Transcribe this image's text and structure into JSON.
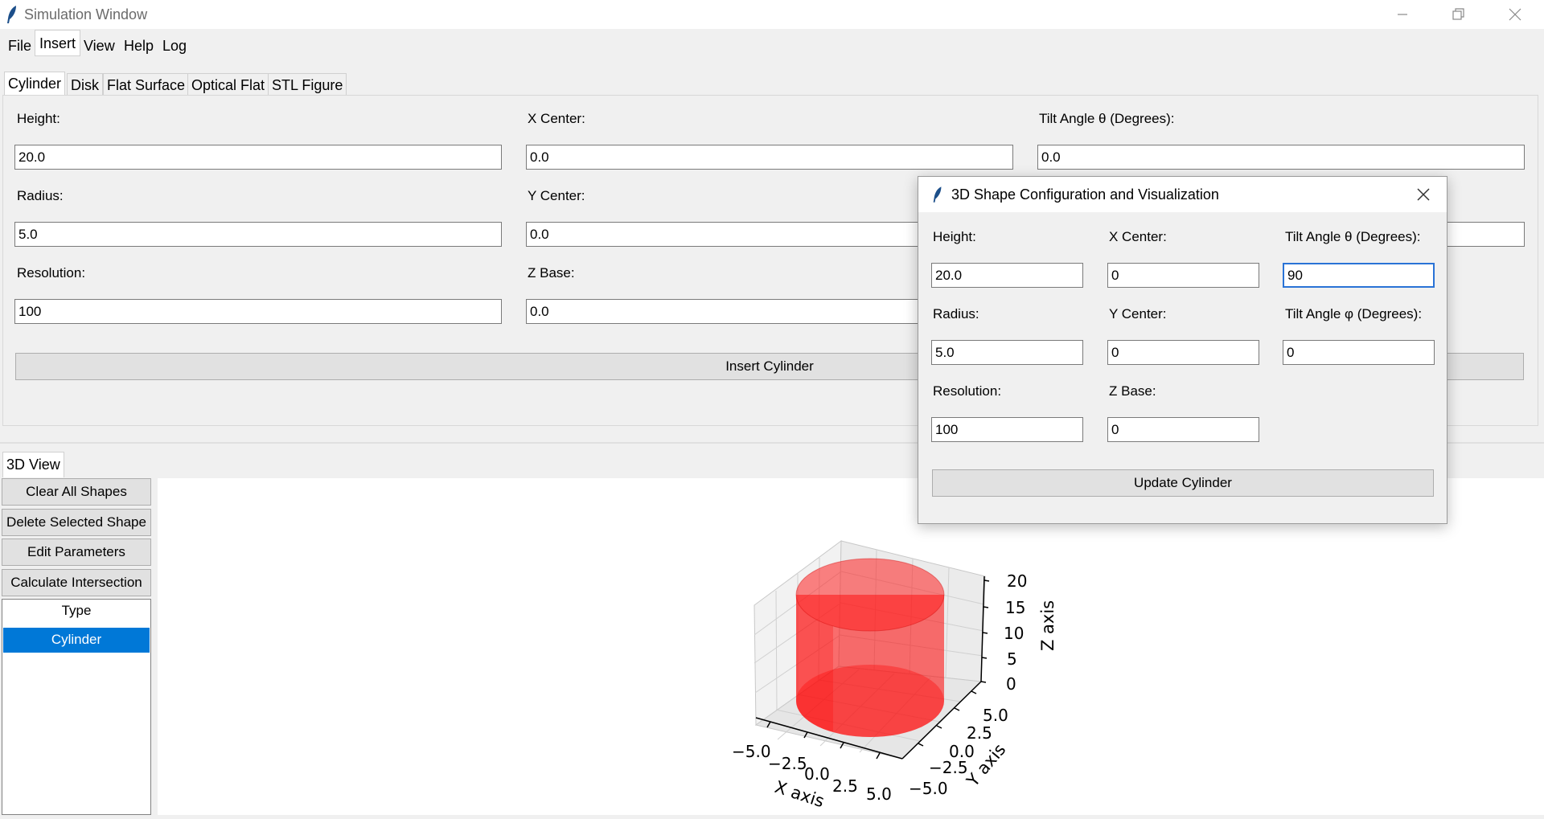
{
  "window": {
    "title": "Simulation Window"
  },
  "menu": [
    "File",
    "Insert",
    "View",
    "Help",
    "Log"
  ],
  "insert_tabs": [
    "Cylinder",
    "Disk",
    "Flat Surface",
    "Optical Flat",
    "STL Figure"
  ],
  "cylinder_form": {
    "height_label": "Height:",
    "height_value": "20.0",
    "radius_label": "Radius:",
    "radius_value": "5.0",
    "resolution_label": "Resolution:",
    "resolution_value": "100",
    "xcenter_label": "X Center:",
    "xcenter_value": "0.0",
    "ycenter_label": "Y Center:",
    "ycenter_value": "0.0",
    "zbase_label": "Z Base:",
    "zbase_value": "0.0",
    "tilt_theta_label": "Tilt Angle θ (Degrees):",
    "tilt_theta_value": "0.0",
    "insert_button": "Insert Cylinder"
  },
  "view_tab": "3D View",
  "side_buttons": [
    "Clear All Shapes",
    "Delete Selected Shape",
    "Edit Parameters",
    "Calculate Intersection"
  ],
  "shape_list": {
    "header": "Type",
    "items": [
      "Cylinder"
    ]
  },
  "dialog": {
    "title": "3D Shape Configuration and Visualization",
    "height_label": "Height:",
    "height_value": "20.0",
    "radius_label": "Radius:",
    "radius_value": "5.0",
    "resolution_label": "Resolution:",
    "resolution_value": "100",
    "xcenter_label": "X Center:",
    "xcenter_value": "0",
    "ycenter_label": "Y Center:",
    "ycenter_value": "0",
    "zbase_label": "Z Base:",
    "zbase_value": "0",
    "tilt_theta_label": "Tilt Angle θ (Degrees):",
    "tilt_theta_value": "90",
    "tilt_phi_label": "Tilt Angle φ (Degrees):",
    "tilt_phi_value": "0",
    "update_button": "Update Cylinder"
  },
  "plot": {
    "xlabel": "X axis",
    "ylabel": "Y axis",
    "zlabel": "Z axis",
    "x_ticks": [
      "−5.0",
      "−2.5",
      "0.0",
      "2.5",
      "5.0"
    ],
    "y_ticks": [
      "−5.0",
      "−2.5",
      "0.0",
      "2.5",
      "5.0"
    ],
    "z_ticks": [
      "0",
      "5",
      "10",
      "15",
      "20"
    ],
    "shape_color": "#ff0000"
  },
  "colors": {
    "selection": "#0078d7",
    "focus": "#2a73d6"
  }
}
